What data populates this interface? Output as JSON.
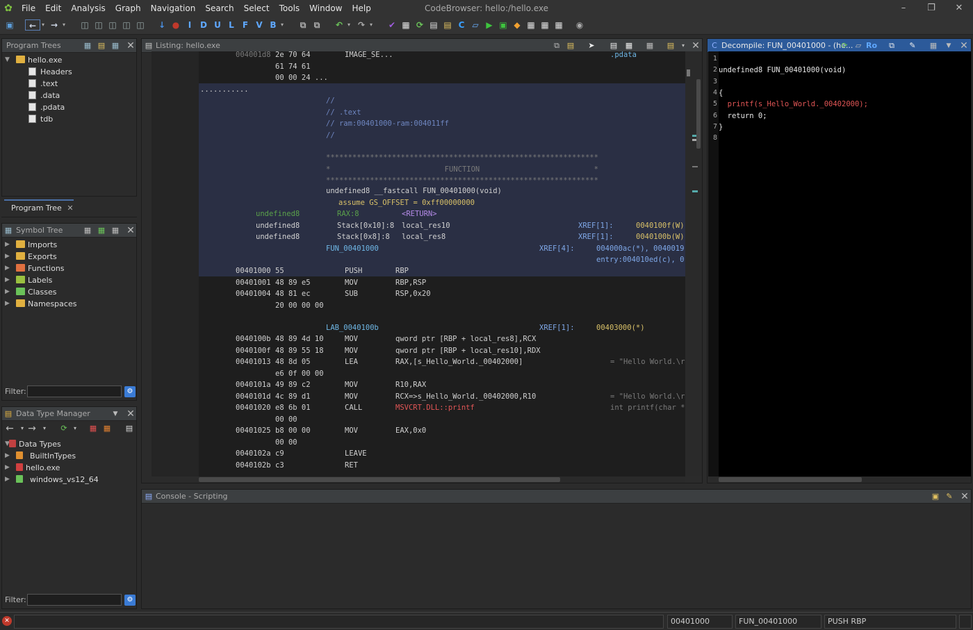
{
  "app": {
    "window_title": "CodeBrowser: hello:/hello.exe",
    "logo_icon": "ghidra-dragon-icon",
    "accent": "#2c5a9a"
  },
  "menu": [
    "File",
    "Edit",
    "Analysis",
    "Graph",
    "Navigation",
    "Search",
    "Select",
    "Tools",
    "Window",
    "Help"
  ],
  "toolbar": {
    "letters": [
      "I",
      "D",
      "U",
      "L",
      "F",
      "V",
      "B"
    ]
  },
  "program_trees": {
    "title": "Program Trees",
    "root": "hello.exe",
    "items": [
      "Headers",
      ".text",
      ".data",
      ".pdata",
      "tdb"
    ],
    "tab_label": "Program Tree"
  },
  "symbol_tree": {
    "title": "Symbol Tree",
    "items": [
      "Imports",
      "Exports",
      "Functions",
      "Labels",
      "Classes",
      "Namespaces"
    ],
    "filter_label": "Filter:"
  },
  "data_type_manager": {
    "title": "Data Type Manager",
    "root": "Data Types",
    "items": [
      "BuiltInTypes",
      "hello.exe",
      "windows_vs12_64"
    ],
    "filter_label": "Filter:"
  },
  "listing": {
    "title": "Listing:  hello.exe",
    "rows": [
      {
        "addr": "004001d8",
        "bytes": "2e 70 64",
        "mn": "IMAGE_SE...",
        "ops": "",
        "ref": ".pdata"
      },
      {
        "addr": "",
        "bytes": "61 74 61",
        "mn": "",
        "ops": "",
        "ref": ""
      },
      {
        "addr": "",
        "bytes": "00 00 24 ...",
        "mn": "",
        "ops": "",
        "ref": ""
      }
    ],
    "dots": "...........",
    "comments": [
      "//",
      "// .text",
      "// ram:00401000-ram:004011ff",
      "//"
    ],
    "stars": "**************************************************************",
    "function_banner": "*                          FUNCTION                          *",
    "signature": "undefined8 __fastcall FUN_00401000(void)",
    "assume": "assume GS_OFFSET = 0xff00000000",
    "vars": [
      {
        "type": "undefined8",
        "loc": "RAX:8",
        "name": "<RETURN>",
        "xref": "",
        "xaddr": ""
      },
      {
        "type": "undefined8",
        "loc": "Stack[0x10]:8",
        "name": "local_res10",
        "xref": "XREF[1]:",
        "xaddr": "0040100f(W)"
      },
      {
        "type": "undefined8",
        "loc": "Stack[0x8]:8",
        "name": "local_res8",
        "xref": "XREF[1]:",
        "xaddr": "0040100b(W)"
      }
    ],
    "func_label": "FUN_00401000",
    "func_xref": "XREF[4]:",
    "func_xaddr1": "004000ac(*), 0040019",
    "func_xaddr2": "entry:004010ed(c), 0",
    "code1": [
      {
        "addr": "00401000",
        "bytes": "55",
        "mn": "PUSH",
        "ops": "RBP",
        "cmt": ""
      },
      {
        "addr": "00401001",
        "bytes": "48 89 e5",
        "mn": "MOV",
        "ops": "RBP,RSP",
        "cmt": ""
      },
      {
        "addr": "00401004",
        "bytes": "48 81 ec",
        "mn": "SUB",
        "ops": "RSP,0x20",
        "cmt": ""
      },
      {
        "addr": "",
        "bytes": "20 00 00 00",
        "mn": "",
        "ops": "",
        "cmt": ""
      }
    ],
    "lab_label": "LAB_0040100b",
    "lab_xref": "XREF[1]:",
    "lab_xaddr": "00403000(*)",
    "code2": [
      {
        "addr": "0040100b",
        "bytes": "48 89 4d 10",
        "mn": "MOV",
        "ops": "qword ptr [RBP + local_res8],RCX",
        "cmt": ""
      },
      {
        "addr": "0040100f",
        "bytes": "48 89 55 18",
        "mn": "MOV",
        "ops": "qword ptr [RBP + local_res10],RDX",
        "cmt": ""
      },
      {
        "addr": "00401013",
        "bytes": "48 8d 05",
        "mn": "LEA",
        "ops": "RAX,[s_Hello_World._00402000]",
        "cmt": "= \"Hello World.\\r"
      },
      {
        "addr": "",
        "bytes": "e6 0f 00 00",
        "mn": "",
        "ops": "",
        "cmt": ""
      },
      {
        "addr": "0040101a",
        "bytes": "49 89 c2",
        "mn": "MOV",
        "ops": "R10,RAX",
        "cmt": ""
      },
      {
        "addr": "0040101d",
        "bytes": "4c 89 d1",
        "mn": "MOV",
        "ops": "RCX=>s_Hello_World._00402000,R10",
        "cmt": "= \"Hello World.\\r"
      },
      {
        "addr": "00401020",
        "bytes": "e8 6b 01",
        "mn": "CALL",
        "ops": "MSVCRT.DLL::printf",
        "cmt": "int printf(char *"
      },
      {
        "addr": "",
        "bytes": "00 00",
        "mn": "",
        "ops": "",
        "cmt": ""
      },
      {
        "addr": "00401025",
        "bytes": "b8 00 00",
        "mn": "MOV",
        "ops": "EAX,0x0",
        "cmt": ""
      },
      {
        "addr": "",
        "bytes": "00 00",
        "mn": "",
        "ops": "",
        "cmt": ""
      },
      {
        "addr": "0040102a",
        "bytes": "c9",
        "mn": "LEAVE",
        "ops": "",
        "cmt": ""
      },
      {
        "addr": "0040102b",
        "bytes": "c3",
        "mn": "RET",
        "ops": "",
        "cmt": ""
      }
    ]
  },
  "decompile": {
    "title": "Decompile: FUN_00401000 - (he...",
    "lines": [
      "",
      "undefined8 FUN_00401000(void)",
      "",
      "{",
      "  printf(s_Hello_World._00402000);",
      "  return 0;",
      "}",
      ""
    ],
    "line_numbers": [
      "1",
      "2",
      "3",
      "4",
      "5",
      "6",
      "7",
      "8"
    ]
  },
  "console": {
    "title": "Console - Scripting"
  },
  "status": {
    "address": "00401000",
    "function": "FUN_00401000",
    "instruction": "PUSH RBP"
  }
}
